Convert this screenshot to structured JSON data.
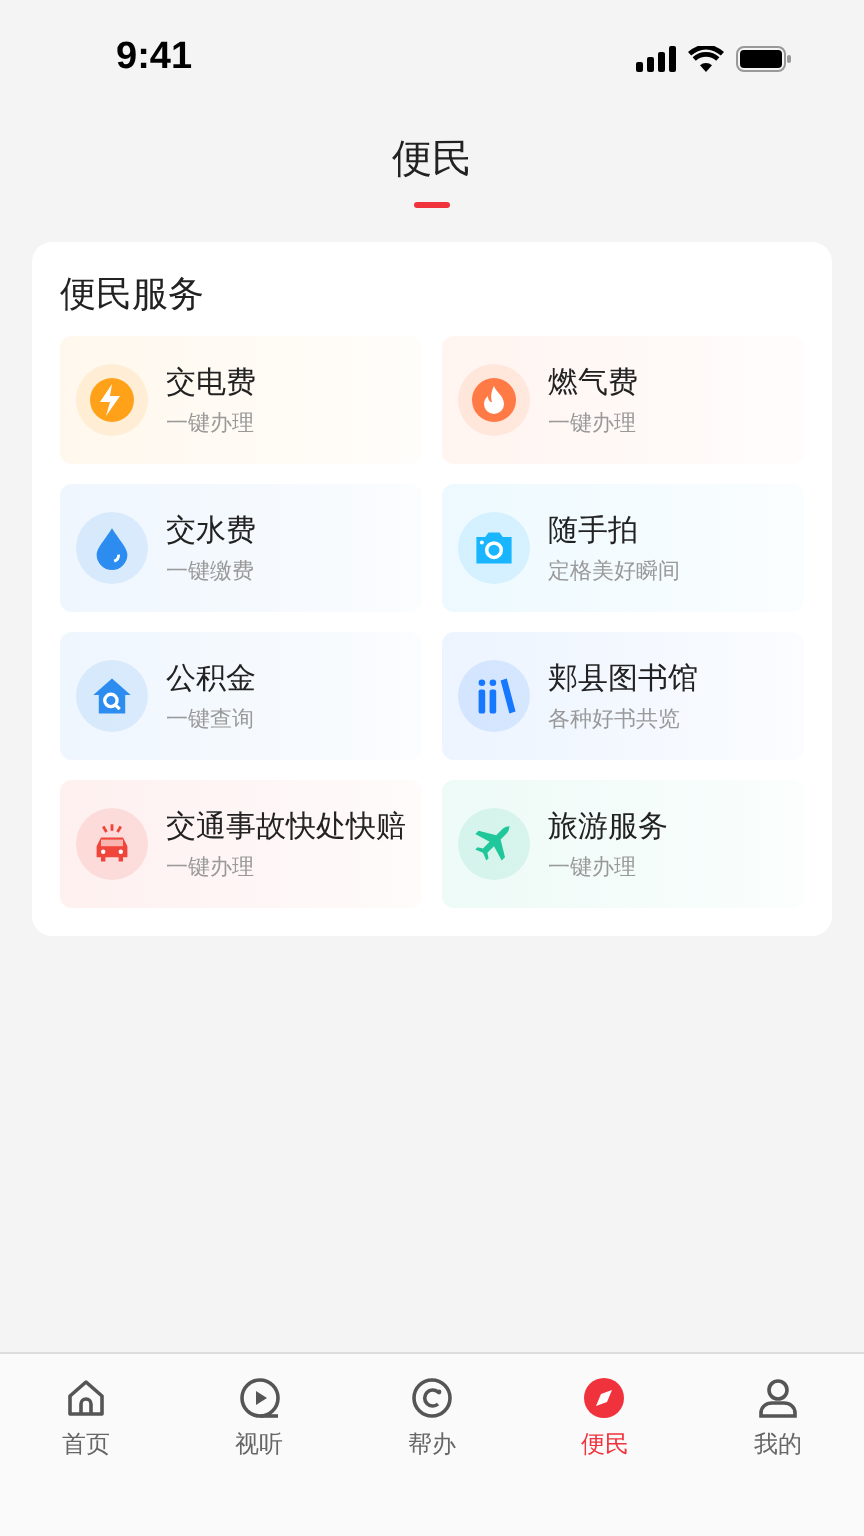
{
  "status_bar": {
    "time": "9:41"
  },
  "header": {
    "title": "便民"
  },
  "section": {
    "title": "便民服务",
    "services": [
      {
        "name": "交电费",
        "subtitle": "一键办理",
        "color": "#ffa21a"
      },
      {
        "name": "燃气费",
        "subtitle": "一键办理",
        "color": "#ff7a45"
      },
      {
        "name": "交水费",
        "subtitle": "一键缴费",
        "color": "#2d8cf0"
      },
      {
        "name": "随手拍",
        "subtitle": "定格美好瞬间",
        "color": "#19b5fe"
      },
      {
        "name": "公积金",
        "subtitle": "一键查询",
        "color": "#2d8cf0"
      },
      {
        "name": "郏县图书馆",
        "subtitle": "各种好书共览",
        "color": "#1677ff"
      },
      {
        "name": "交通事故快处快赔",
        "subtitle": "一键办理",
        "color": "#f0453a"
      },
      {
        "name": "旅游服务",
        "subtitle": "一键办理",
        "color": "#1fc79a"
      }
    ]
  },
  "tab_bar": [
    {
      "label": "首页",
      "selected": false
    },
    {
      "label": "视听",
      "selected": false
    },
    {
      "label": "帮办",
      "selected": false
    },
    {
      "label": "便民",
      "selected": true
    },
    {
      "label": "我的",
      "selected": false
    }
  ]
}
